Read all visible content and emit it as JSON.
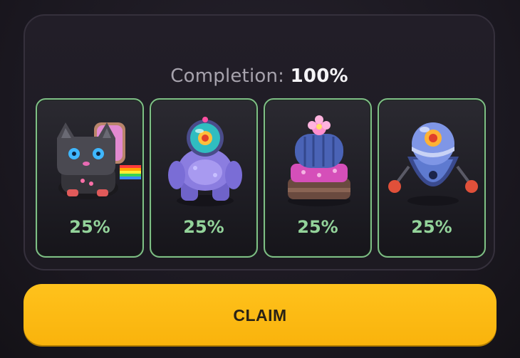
{
  "panel": {
    "completion_label": "Completion:",
    "completion_value": "100%"
  },
  "cards": [
    {
      "name": "rainbow-cat-robot-icon",
      "percent": "25%"
    },
    {
      "name": "purple-astronaut-robot-icon",
      "percent": "25%"
    },
    {
      "name": "cactus-creature-icon",
      "percent": "25%"
    },
    {
      "name": "one-eyed-bomb-robot-icon",
      "percent": "25%"
    }
  ],
  "claim": {
    "label": "CLAIM"
  },
  "colors": {
    "card_border": "#7fbf86",
    "percent_text": "#93d39a",
    "claim_button": "#ffc21c"
  }
}
